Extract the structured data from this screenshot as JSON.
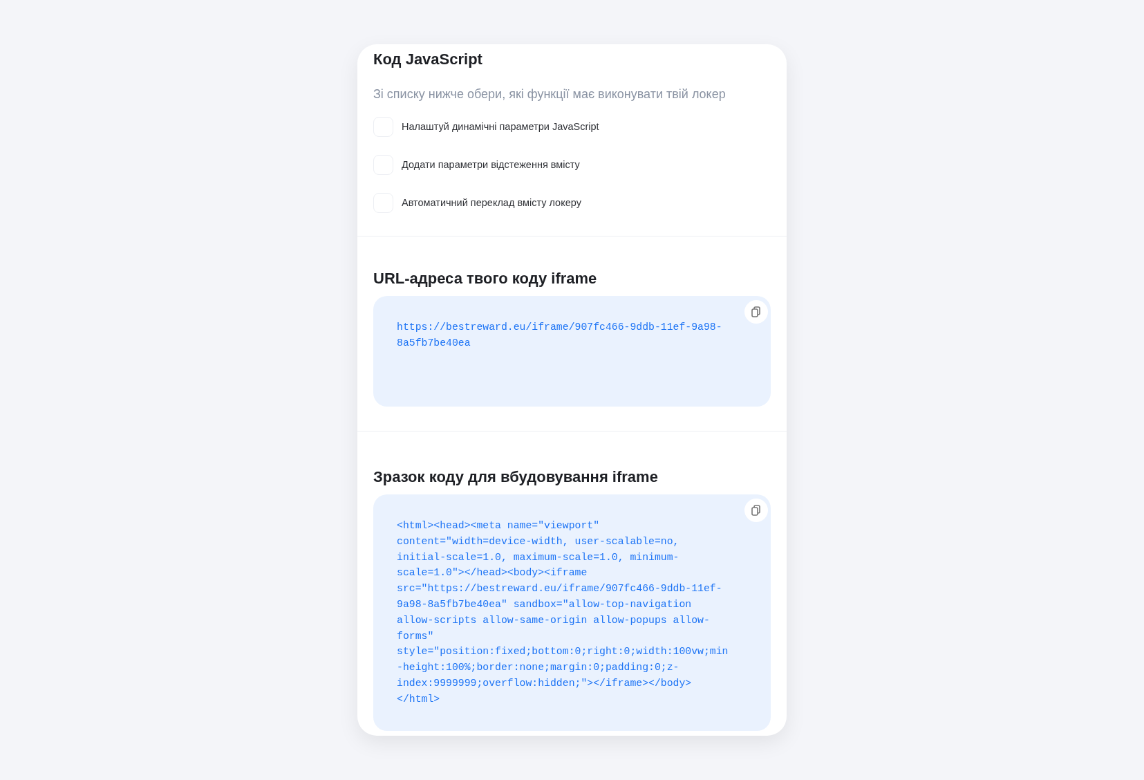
{
  "sections": [
    {
      "kind": "options",
      "title": "Код JavaScript",
      "subtitle": "Зі списку нижче обери, які функції має виконувати твій локер",
      "options": [
        {
          "label": "Налаштуй динамічні параметри JavaScript",
          "checked": false
        },
        {
          "label": "Додати параметри відстеження вмісту",
          "checked": false
        },
        {
          "label": "Автоматичний переклад вмісту локеру",
          "checked": false
        }
      ]
    },
    {
      "kind": "code",
      "title": "URL-адреса твого коду iframe",
      "code_lines": [
        "https://bestreward.eu/iframe/907fc466-9ddb-11ef-9a98-",
        "8a5fb7be40ea"
      ]
    },
    {
      "kind": "code",
      "title": "Зразок коду для вбудовування iframe",
      "code_lines": [
        "<html><head><meta name=\"viewport\"",
        "content=\"width=device-width, user-scalable=no,",
        "initial-scale=1.0, maximum-scale=1.0, minimum-",
        "scale=1.0\"></head><body><iframe",
        "src=\"https://bestreward.eu/iframe/907fc466-9ddb-11ef-",
        "9a98-8a5fb7be40ea\" sandbox=\"allow-top-navigation",
        "allow-scripts allow-same-origin allow-popups allow-",
        "forms\"",
        "style=\"position:fixed;bottom:0;right:0;width:100vw;min",
        "-height:100%;border:none;margin:0;padding:0;z-",
        "index:9999999;overflow:hidden;\"></iframe></body>",
        "</html>"
      ]
    }
  ]
}
